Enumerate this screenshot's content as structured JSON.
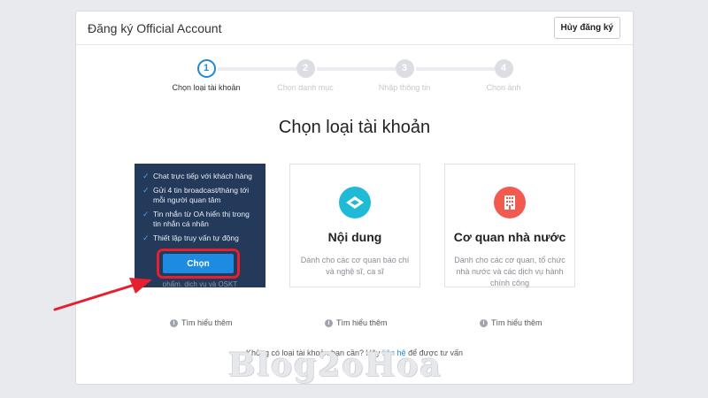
{
  "header": {
    "title": "Đăng ký Official Account",
    "cancel_label": "Hủy đăng ký"
  },
  "stepper": {
    "steps": [
      {
        "number": "1",
        "label": "Chọn loại tài khoản"
      },
      {
        "number": "2",
        "label": "Chọn danh mục"
      },
      {
        "number": "3",
        "label": "Nhập thông tin"
      },
      {
        "number": "4",
        "label": "Chọn ảnh"
      }
    ],
    "active_index": 0,
    "accent_color": "#1e88d9"
  },
  "main": {
    "title": "Chọn loại tài khoản",
    "cards": [
      {
        "features": [
          "Chat trực tiếp với khách hàng",
          "Gửi 4 tin broadcast/tháng tới mỗi người quan tâm",
          "Tin nhắn từ OA hiển thị trong tin nhắn cá nhân",
          "Thiết lập truy vấn tự động"
        ],
        "choose_label": "Chọn",
        "under_text": "phẩm, dịch vụ và OSKT",
        "learn_more": "Tìm hiểu thêm"
      },
      {
        "icon": "content-icon",
        "title": "Nội dung",
        "description": "Dành cho các cơ quan báo chí và nghệ sĩ, ca sĩ",
        "learn_more": "Tìm hiểu thêm",
        "icon_color": "#1fbad6"
      },
      {
        "icon": "building-icon",
        "title": "Cơ quan nhà nước",
        "description": "Dành cho các cơ quan, tổ chức nhà nước và các dịch vụ hành chính công",
        "learn_more": "Tìm hiểu thêm",
        "icon_color": "#f05a4f"
      }
    ]
  },
  "footer": {
    "prefix": "Không có loại tài khoản bạn cần? Hãy ",
    "link": "liên hệ",
    "suffix": " để được tư vấn"
  },
  "watermark": "Blog2oHoa",
  "highlight_color": "#e5202f"
}
